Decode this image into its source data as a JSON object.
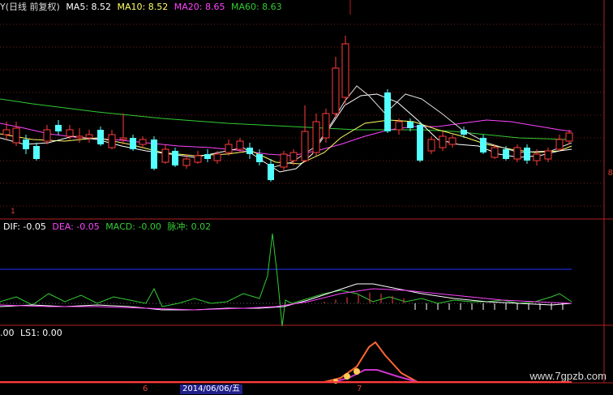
{
  "main_legend": {
    "prefix": "Y(日线 前复权)",
    "ma5": "MA5: 8.52",
    "ma10": "MA10: 8.52",
    "ma20": "MA20: 8.65",
    "ma60": "MA60: 8.63"
  },
  "macd_legend": {
    "dif": "DIF: -0.05",
    "dea": "DEA: -0.05",
    "macd": "MACD: -0.00",
    "pulse": "脉冲: 0.02"
  },
  "ls_legend": {
    "prefix": ".00",
    "ls1": "LS1: 0.00"
  },
  "axis": {
    "right_mark": "8",
    "bottom_tick_1": "6",
    "bottom_tick_2": "7",
    "small_mark": "1"
  },
  "cursor_date": "2014/06/06/五",
  "watermark": "www.7gpzb.com",
  "colors": {
    "up": "#ff3c3c",
    "down": "#54ffff",
    "ma5": "#ffffff",
    "ma10": "#ffff66",
    "ma20": "#ff44ff",
    "ma60": "#33cc33",
    "panel_border": "#b02020"
  },
  "chart_data": {
    "type": "candlestick",
    "panels": [
      "price",
      "macd",
      "ls"
    ]
  }
}
